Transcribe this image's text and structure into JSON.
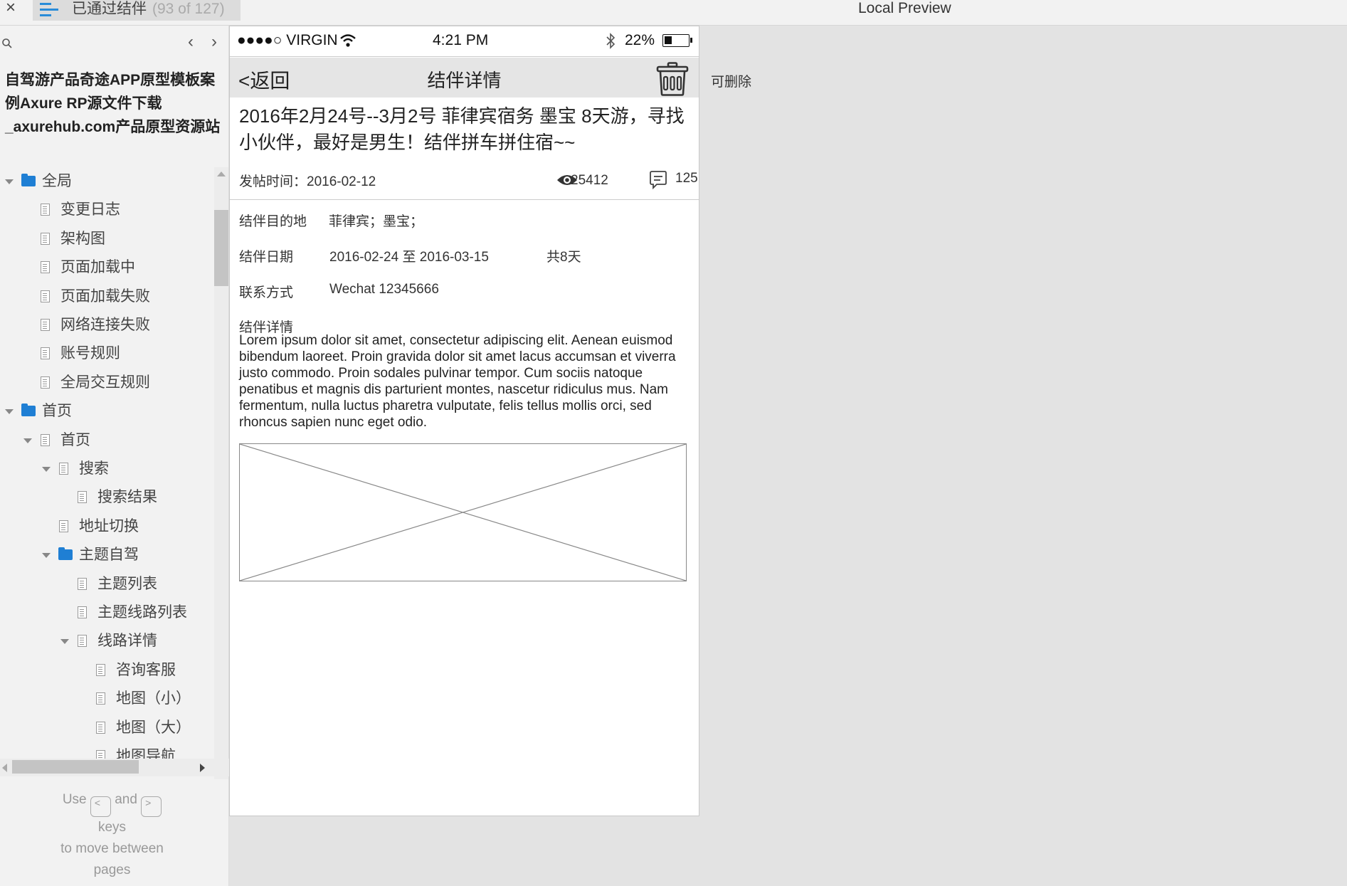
{
  "topbar": {
    "close_glyph": "×",
    "page_name": "已通过结伴",
    "page_count": "(93 of 127)",
    "preview_title": "Local Preview"
  },
  "sidebar": {
    "project_title": "自驾游产品奇途APP原型模板案例Axure RP源文件下载_axurehub.com产品原型资源站",
    "prev_glyph": "‹",
    "next_glyph": "›",
    "tree": [
      {
        "label": "全局",
        "type": "folder",
        "level": 0,
        "expanded": true
      },
      {
        "label": "变更日志",
        "type": "page",
        "level": 1
      },
      {
        "label": "架构图",
        "type": "page",
        "level": 1
      },
      {
        "label": "页面加载中",
        "type": "page",
        "level": 1
      },
      {
        "label": "页面加载失败",
        "type": "page",
        "level": 1
      },
      {
        "label": "网络连接失败",
        "type": "page",
        "level": 1
      },
      {
        "label": "账号规则",
        "type": "page",
        "level": 1
      },
      {
        "label": "全局交互规则",
        "type": "page",
        "level": 1
      },
      {
        "label": "首页",
        "type": "folder",
        "level": 0,
        "expanded": true
      },
      {
        "label": "首页",
        "type": "page",
        "level": 1,
        "expanded": true
      },
      {
        "label": "搜索",
        "type": "page",
        "level": 2,
        "expanded": true
      },
      {
        "label": "搜索结果",
        "type": "page",
        "level": 3
      },
      {
        "label": "地址切换",
        "type": "page",
        "level": 2
      },
      {
        "label": "主题自驾",
        "type": "folder",
        "level": 2,
        "expanded": true
      },
      {
        "label": "主题列表",
        "type": "page",
        "level": 3
      },
      {
        "label": "主题线路列表",
        "type": "page",
        "level": 3
      },
      {
        "label": "线路详情",
        "type": "page",
        "level": 3,
        "expanded": true
      },
      {
        "label": "咨询客服",
        "type": "page",
        "level": 4
      },
      {
        "label": "地图（小）",
        "type": "page",
        "level": 4
      },
      {
        "label": "地图（大）",
        "type": "page",
        "level": 4
      },
      {
        "label": "地图导航",
        "type": "page",
        "level": 4
      }
    ],
    "hint": {
      "use": "Use",
      "key_prev": "<",
      "and": "and",
      "key_next": ">",
      "keys": "keys",
      "to_move": "to move between",
      "pages": "pages"
    }
  },
  "phone": {
    "status": {
      "carrier": "●●●●○ VIRGIN",
      "time": "4:21 PM",
      "battery": "22%"
    },
    "nav": {
      "back": "<返回",
      "title": "结伴详情"
    },
    "post": {
      "title": "2016年2月24号--3月2号 菲律宾宿务 墨宝 8天游，寻找小伙伴，最好是男生！结伴拼车拼住宿~~",
      "posted_label": "发帖时间：",
      "posted_date": "2016-02-12",
      "views": "25412",
      "comments": "125"
    },
    "info": {
      "dest_label": "结伴目的地",
      "dest_value": "菲律宾；墨宝；",
      "date_label": "结伴日期",
      "date_value": "2016-02-24 至 2016-03-15",
      "days": "共8天",
      "contact_label": "联系方式",
      "contact_value": "Wechat 12345666"
    },
    "detail_label": "结伴详情",
    "detail_text": "Lorem ipsum dolor sit amet, consectetur adipiscing elit. Aenean euismod bibendum laoreet. Proin gravida dolor sit amet lacus accumsan et viverra justo commodo. Proin sodales pulvinar tempor. Cum sociis natoque penatibus et magnis dis parturient montes, nascetur ridiculus mus. Nam fermentum, nulla luctus pharetra vulputate, felis tellus mollis orci, sed rhoncus sapien nunc eget odio."
  },
  "annotation": {
    "deletable": "可删除"
  },
  "colors": {
    "accent": "#1f7fd4",
    "nav_bg": "#e5e5e5",
    "page_bg": "#e3e3e3"
  }
}
